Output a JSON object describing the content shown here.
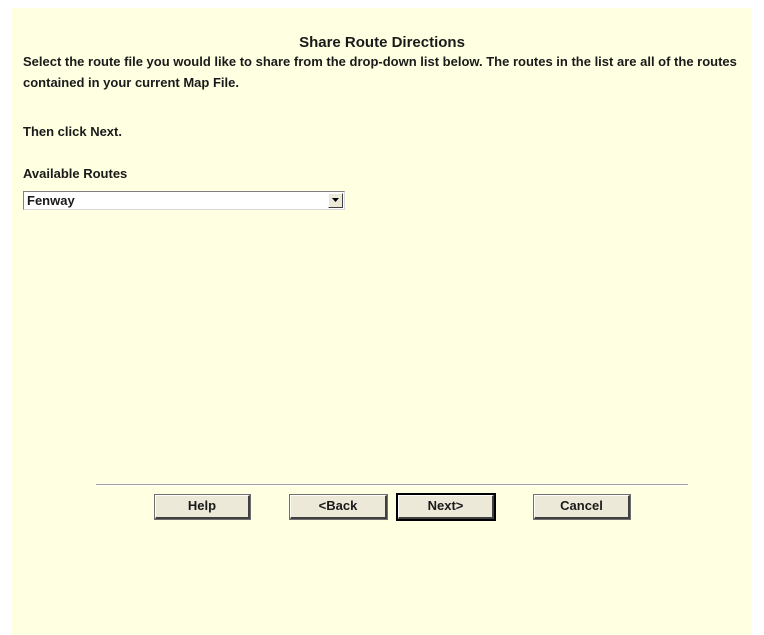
{
  "dialog": {
    "title": "Share Route Directions",
    "instructions": "Select the route file you would like to share from the drop-down list below. The routes in the list are all of the routes contained in your current Map File.",
    "then_click": "Then click Next.",
    "routes_label": "Available Routes",
    "routes_select": {
      "selected": "Fenway"
    }
  },
  "buttons": {
    "help": "Help",
    "back": "<Back",
    "next": "Next>",
    "cancel": "Cancel"
  },
  "icons": {
    "dropdown": "chevron-down-icon"
  }
}
